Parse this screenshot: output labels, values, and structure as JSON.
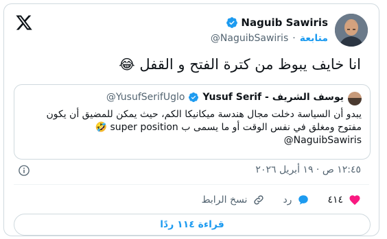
{
  "author": {
    "name": "Naguib Sawiris",
    "handle": "@NaguibSawiris",
    "follow_label": "متابعة",
    "separator": "·"
  },
  "tweet": {
    "text": "انا خايف  يبوظ من كترة الفتح و القفل",
    "emoji": "😂"
  },
  "quote": {
    "name": "يوسف الشريف - Yusuf Serif",
    "handle": "@YusufSerifUglo",
    "body": "يبدو أن السياسة دخلت مجال هندسة ميكانيكا الكم، حيث يمكن للمضيق أن يكون مفتوح ومغلق في نفس الوقت أو ما يسمى ب super position 🤣",
    "mention": "@NaguibSawiris"
  },
  "timestamp": "١٢:٤٥ ص · ١٩ أبريل ٢٠٢٦",
  "actions": {
    "like_count": "٤١٤",
    "reply_label": "رد",
    "copy_link_label": "نسخ الرابط"
  },
  "read_replies_label": "قراءة ١١٤ ردًا",
  "colors": {
    "accent": "#1d9bf0",
    "like": "#f91880",
    "text": "#0f1419",
    "muted": "#536471"
  }
}
